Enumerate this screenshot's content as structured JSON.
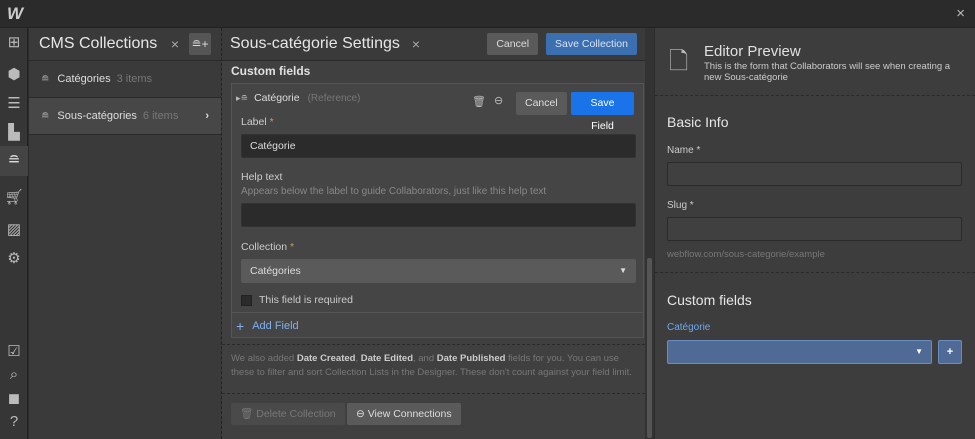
{
  "app": {
    "logo": "W",
    "close": "×"
  },
  "rail": {
    "icons": [
      "add-panel-icon",
      "box-icon",
      "navigator-icon",
      "pages-icon",
      "cms-icon",
      "ecommerce-icon",
      "assets-icon",
      "settings-icon",
      "tasks-icon",
      "search-icon",
      "video-icon",
      "help-icon"
    ]
  },
  "cms": {
    "title": "CMS Collections",
    "close": "×",
    "collections": [
      {
        "name": "Catégories",
        "count": "3 items"
      },
      {
        "name": "Sous-catégories",
        "count": "6 items"
      }
    ]
  },
  "settings": {
    "title": "Sous-catégorie Settings",
    "close": "×",
    "cancel": "Cancel",
    "save": "Save Collection",
    "custom_fields": "Custom fields",
    "field": {
      "name": "Catégorie",
      "type": "(Reference)",
      "cancel": "Cancel",
      "save": "Save Field",
      "label_label": "Label",
      "label_value": "Catégorie",
      "help_label": "Help text",
      "help_desc": "Appears below the label to guide Collaborators, just like this help text",
      "help_value": "",
      "collection_label": "Collection",
      "collection_value": "Catégories",
      "required": "This field is required"
    },
    "add_field": "Add Field",
    "note": {
      "p1": "We also added ",
      "b1": "Date Created",
      ",": ", ",
      "b2": "Date Edited",
      "p2": ", and ",
      "b3": "Date Published",
      "p3": " fields for you. You can use these to filter and sort Collection Lists in the Designer. These don't count against your field limit."
    },
    "delete": "Delete Collection",
    "connections": "View Connections"
  },
  "preview": {
    "title": "Editor Preview",
    "subtitle": "This is the form that Collaborators will see when creating a new Sous-catégorie",
    "basic": "Basic Info",
    "name": "Name *",
    "slug": "Slug *",
    "slug_hint": "webflow.com/sous-categorie/example",
    "custom": "Custom fields",
    "cat_label": "Catégorie",
    "add": "+"
  }
}
